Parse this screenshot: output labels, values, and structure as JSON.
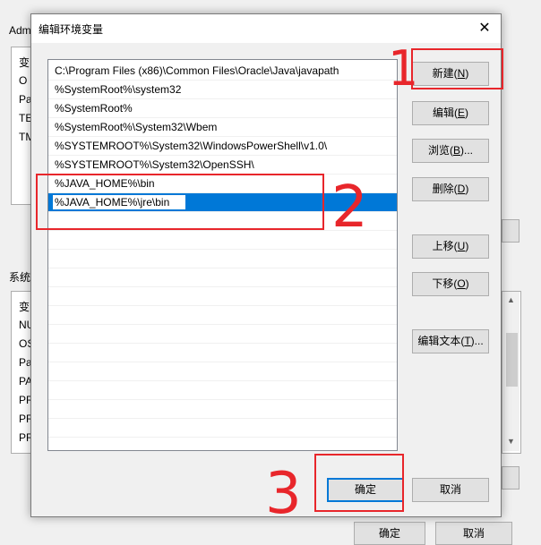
{
  "parent_window": {
    "title_fragment": "Adm",
    "system_label_fragment": "系统",
    "user_list_header": "变",
    "user_vars": [
      "O",
      "Pa",
      "TE",
      "TM"
    ],
    "system_list_header": "变",
    "system_vars": [
      "NU",
      "OS",
      "Pa",
      "PA",
      "PR",
      "PR",
      "PR"
    ],
    "ok_label": "确定",
    "cancel_label": "取消"
  },
  "dialog": {
    "title": "编辑环境变量",
    "close_glyph": "✕",
    "paths": [
      "C:\\Program Files (x86)\\Common Files\\Oracle\\Java\\javapath",
      "%SystemRoot%\\system32",
      "%SystemRoot%",
      "%SystemRoot%\\System32\\Wbem",
      "%SYSTEMROOT%\\System32\\WindowsPowerShell\\v1.0\\",
      "%SYSTEMROOT%\\System32\\OpenSSH\\",
      "%JAVA_HOME%\\bin"
    ],
    "editing_value": "%JAVA_HOME%\\jre\\bin",
    "buttons": {
      "new": {
        "text": "新建(",
        "key": "N",
        "close": ")"
      },
      "edit": {
        "text": "编辑(",
        "key": "E",
        "close": ")"
      },
      "browse": {
        "text": "浏览(",
        "key": "B",
        "close": ")..."
      },
      "delete": {
        "text": "删除(",
        "key": "D",
        "close": ")"
      },
      "move_up": {
        "text": "上移(",
        "key": "U",
        "close": ")"
      },
      "move_down": {
        "text": "下移(",
        "key": "O",
        "close": ")"
      },
      "edit_text": {
        "text": "编辑文本(",
        "key": "T",
        "close": ")..."
      },
      "ok": "确定",
      "cancel": "取消"
    }
  },
  "annotations": {
    "step1": "1",
    "step2": "2",
    "step3": "3",
    "color": "#e8262b"
  }
}
